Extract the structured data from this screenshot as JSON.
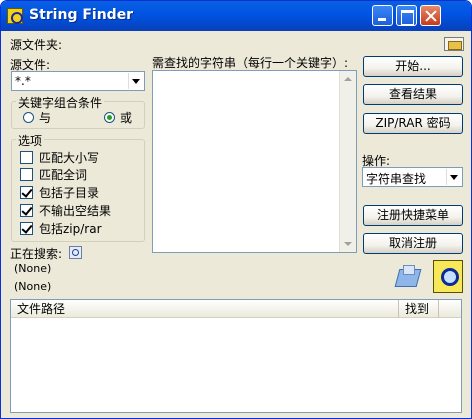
{
  "window": {
    "title": "String Finder"
  },
  "source_folder": {
    "label": "源文件夹:"
  },
  "source_file": {
    "label": "源文件:",
    "value": "*.*"
  },
  "search_strings": {
    "label": "需查找的字符串（每行一个关键字）:",
    "value": ""
  },
  "keyword_group": {
    "title": "关键字组合条件",
    "options": [
      {
        "label": "与",
        "selected": false
      },
      {
        "label": "或",
        "selected": true
      }
    ]
  },
  "options_group": {
    "title": "选项",
    "items": [
      {
        "label": "匹配大小写",
        "checked": false
      },
      {
        "label": "匹配全词",
        "checked": false
      },
      {
        "label": "包括子目录",
        "checked": true
      },
      {
        "label": "不输出空结果",
        "checked": true
      },
      {
        "label": "包括zip/rar",
        "checked": true
      }
    ]
  },
  "buttons": {
    "start": "开始...",
    "view_results": "查看结果",
    "zip_password": "ZIP/RAR 密码",
    "register_menu": "注册快捷菜单",
    "unregister": "取消注册"
  },
  "operation": {
    "label": "操作:",
    "value": "字符串查找"
  },
  "status": {
    "label": "正在搜索:",
    "line1": "(None)",
    "line2": "(None)"
  },
  "results_table": {
    "columns": [
      "文件路径",
      "找到"
    ],
    "rows": []
  }
}
